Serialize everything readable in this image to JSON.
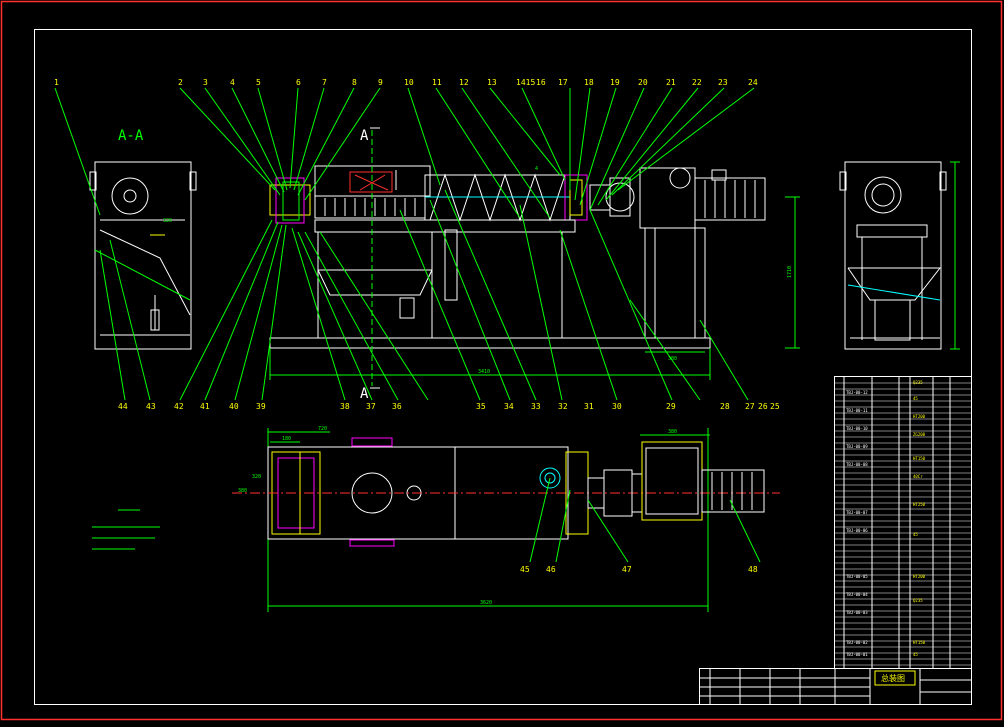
{
  "drawing": {
    "section_title": "A-A",
    "section_mark": "A",
    "title_block_name": "总装图",
    "corner_mark": "4",
    "balloons_top": [
      "1",
      "2",
      "3",
      "4",
      "5",
      "6",
      "7",
      "8",
      "9",
      "10",
      "11",
      "12",
      "13",
      "1415",
      "16",
      "17",
      "18",
      "19",
      "20",
      "21",
      "22",
      "23",
      "24"
    ],
    "balloons_bottom": [
      "44",
      "43",
      "42",
      "41",
      "40",
      "39",
      "38",
      "37",
      "36",
      "35",
      "34",
      "33",
      "32",
      "31",
      "30",
      "29",
      "28",
      "27",
      "26",
      "25"
    ],
    "balloons_plan": [
      "45",
      "46",
      "47",
      "48"
    ],
    "dims": {
      "overall_len": "3410",
      "plan_len": "3620",
      "height": "1710",
      "motor_base": "380",
      "plan_a": "720",
      "plan_b": "380",
      "plan_c": "180",
      "side_h": "320",
      "side_w": "380"
    }
  },
  "bom": {
    "codes": [
      "TBJ-00-12",
      "TBJ-00-11",
      "TBJ-00-10",
      "TBJ-00-09",
      "TBJ-00-08",
      "TBJ-00-07",
      "TBJ-00-06",
      "TBJ-00-05",
      "TBJ-00-04",
      "TBJ-00-03",
      "TBJ-00-02",
      "TBJ-00-01"
    ],
    "materials": [
      "Q235",
      "45",
      "HT200",
      "ZG200",
      "HT150",
      "40Cr",
      "HT250",
      "45",
      "HT200",
      "Q235",
      "HT150",
      "45"
    ]
  }
}
